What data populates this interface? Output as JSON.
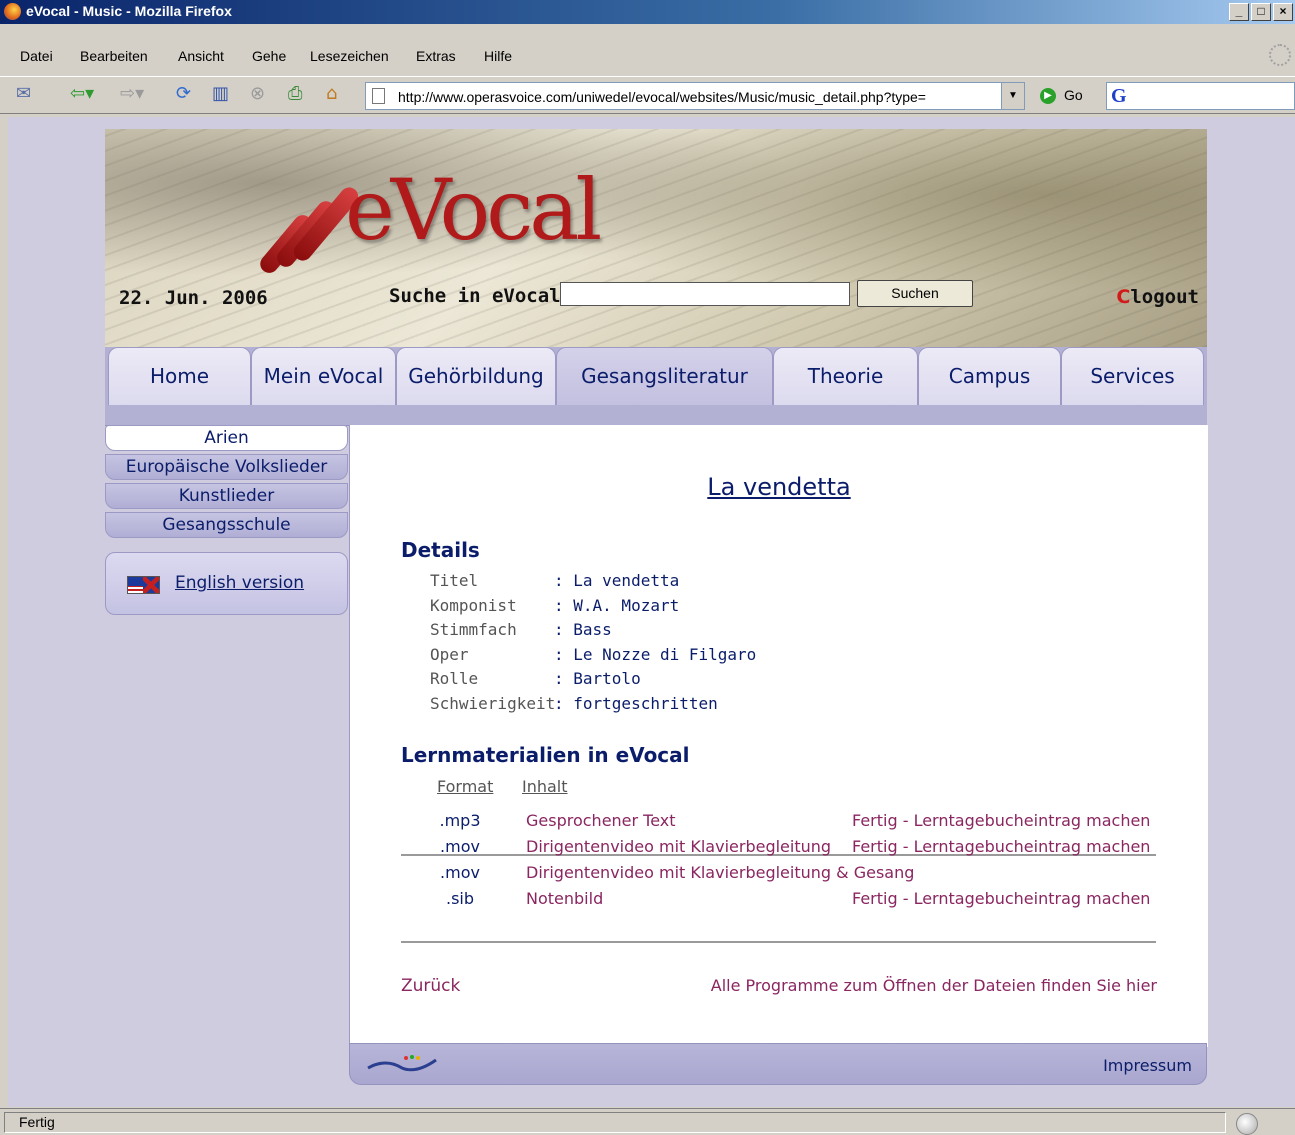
{
  "window": {
    "title": "eVocal - Music - Mozilla Firefox",
    "minimize": "_",
    "maximize": "□",
    "close": "×"
  },
  "menu": [
    "Datei",
    "Bearbeiten",
    "Ansicht",
    "Gehe",
    "Lesezeichen",
    "Extras",
    "Hilfe"
  ],
  "toolbar": {
    "url": "http://www.operasvoice.com/uniwedel/evocal/websites/Music/music_detail.php?type=",
    "go_label": "Go",
    "icons": [
      "mail-icon",
      "back-icon",
      "forward-icon",
      "reload-icon",
      "bookmarks-icon",
      "stop-icon",
      "print-icon",
      "home-icon"
    ]
  },
  "header": {
    "logo": "eVocal",
    "date": "22. Jun. 2006",
    "search_label": "Suche in eVocal",
    "search_button": "Suchen",
    "logout_c": "C",
    "logout_rest": "logout"
  },
  "tabs": [
    "Home",
    "Mein eVocal",
    "Gehörbildung",
    "Gesangsliteratur",
    "Theorie",
    "Campus",
    "Services"
  ],
  "active_tab": "Gesangsliteratur",
  "sidebar": {
    "items": [
      "Arien",
      "Europäische Volkslieder",
      "Kunstlieder",
      "Gesangsschule"
    ],
    "active": "Arien",
    "english_link": "English version"
  },
  "content": {
    "song_title": "La vendetta",
    "details_heading": "Details",
    "details": [
      {
        "key": "Titel",
        "value": ": La vendetta"
      },
      {
        "key": "Komponist",
        "value": ": W.A. Mozart"
      },
      {
        "key": "Stimmfach",
        "value": ": Bass"
      },
      {
        "key": "Oper",
        "value": ": Le Nozze di Filgaro"
      },
      {
        "key": "Rolle",
        "value": ": Bartolo"
      },
      {
        "key": "Schwierigkeit",
        "value": ": fortgeschritten"
      }
    ],
    "materials_heading": "Lernmaterialien in eVocal",
    "col_format": "Format",
    "col_inhalt": "Inhalt",
    "materials": [
      {
        "format": ".mp3",
        "inhalt": "Gesprochener Text",
        "status": "Fertig - Lerntagebucheintrag machen"
      },
      {
        "format": ".mov",
        "inhalt": "Dirigentenvideo mit Klavierbegleitung",
        "status": "Fertig - Lerntagebucheintrag machen"
      },
      {
        "format": ".mov",
        "inhalt": "Dirigentenvideo mit Klavierbegleitung & Gesang",
        "status": ""
      },
      {
        "format": ".sib",
        "inhalt": "Notenbild",
        "status": "Fertig - Lerntagebucheintrag machen"
      }
    ],
    "back_link": "Zurück",
    "programs_link": "Alle Programme zum Öffnen der Dateien finden Sie hier"
  },
  "footer": {
    "impressum": "Impressum"
  },
  "status": {
    "text": "Fertig"
  },
  "colors": {
    "nav_text": "#0b1d6a",
    "link_red": "#8a2660",
    "tab_bg": "#b3b1d3",
    "logo_red": "#b11a1a"
  }
}
